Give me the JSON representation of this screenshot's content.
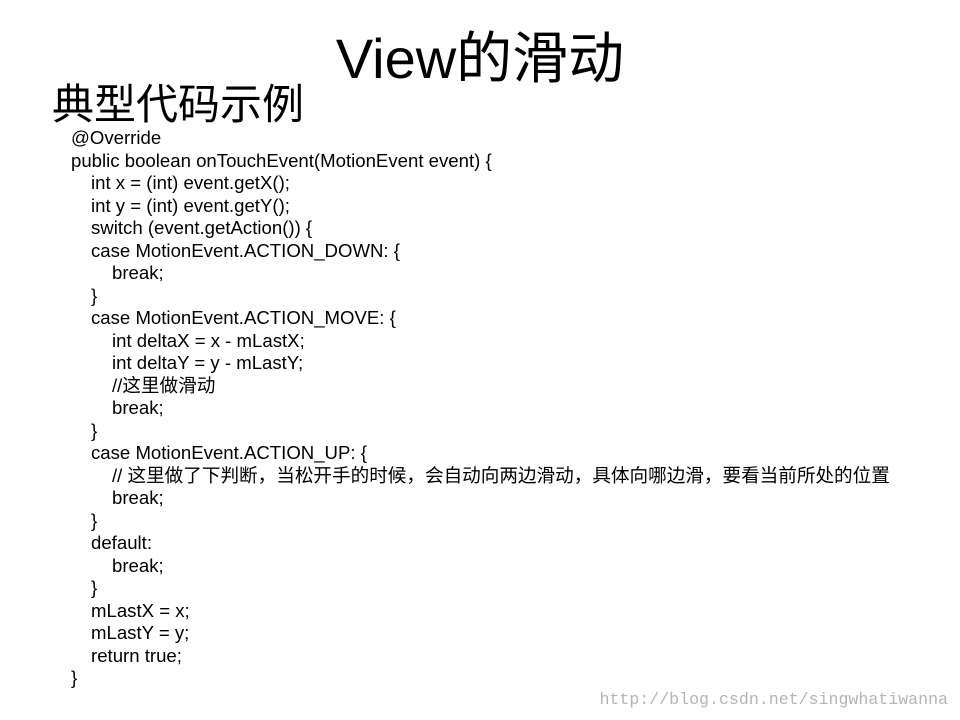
{
  "slide": {
    "title": "View的滑动",
    "subtitle": "典型代码示例"
  },
  "code": {
    "lines": [
      "@Override",
      "public boolean onTouchEvent(MotionEvent event) {",
      "int x = (int) event.getX();",
      "int y = (int) event.getY();",
      "switch (event.getAction()) {",
      "case MotionEvent.ACTION_DOWN: {",
      "break;",
      "}",
      "case MotionEvent.ACTION_MOVE: {",
      "int deltaX = x - mLastX;",
      "int deltaY = y - mLastY;",
      "//这里做滑动",
      "break;",
      "}",
      "case MotionEvent.ACTION_UP: {",
      "// 这里做了下判断，当松开手的时候，会自动向两边滑动，具体向哪边滑，要看当前所处的位置",
      "break;",
      "}",
      "default:",
      "break;",
      "}",
      "mLastX = x;",
      "mLastY = y;",
      "return true;",
      "}"
    ]
  },
  "watermark": "http://blog.csdn.net/singwhatiwanna",
  "colors": {
    "background": "#ffffff",
    "text": "#000000",
    "watermark": "#b4b4b4"
  }
}
